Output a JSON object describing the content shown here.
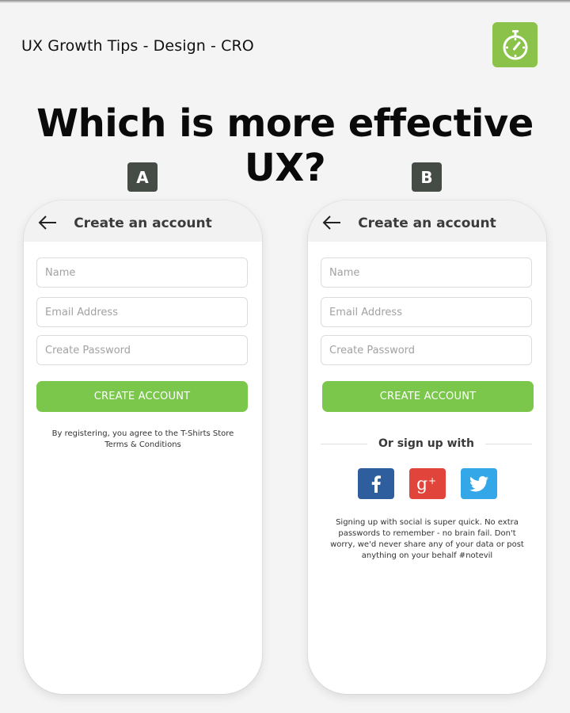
{
  "brand": {
    "title": "UX Growth Tips - Design - CRO",
    "logo_icon": "stopwatch-icon",
    "logo_color": "#8bc34a"
  },
  "headline": "Which is more effective UX?",
  "variants": [
    {
      "badge": "A",
      "screen": {
        "back_icon": "arrow-left-icon",
        "title": "Create an account",
        "fields": [
          {
            "placeholder": "Name",
            "value": ""
          },
          {
            "placeholder": "Email Address",
            "value": ""
          },
          {
            "placeholder": "Create Password",
            "value": ""
          }
        ],
        "cta_label": "CREATE ACCOUNT",
        "terms_line1": "By registering, you agree to the T-Shirts Store",
        "terms_line2": "Terms & Conditions"
      }
    },
    {
      "badge": "B",
      "screen": {
        "back_icon": "arrow-left-icon",
        "title": "Create an account",
        "fields": [
          {
            "placeholder": "Name",
            "value": ""
          },
          {
            "placeholder": "Email Address",
            "value": ""
          },
          {
            "placeholder": "Create Password",
            "value": ""
          }
        ],
        "cta_label": "CREATE ACCOUNT",
        "divider_label": "Or sign up with",
        "social": [
          {
            "name": "Facebook",
            "icon": "facebook-icon",
            "color": "#2f5e9f"
          },
          {
            "name": "Google+",
            "icon": "google-plus-icon",
            "color": "#e0443a"
          },
          {
            "name": "Twitter",
            "icon": "twitter-icon",
            "color": "#34a7e8"
          }
        ],
        "social_note": "Signing up with social is super quick. No extra passwords to remember - no brain fail. Don't worry, we'd never share any of your data or post anything on your behalf #notevil"
      }
    }
  ],
  "colors": {
    "accent_green": "#7ac74b",
    "badge_bg": "#454c45",
    "background": "#f4f4f4"
  }
}
